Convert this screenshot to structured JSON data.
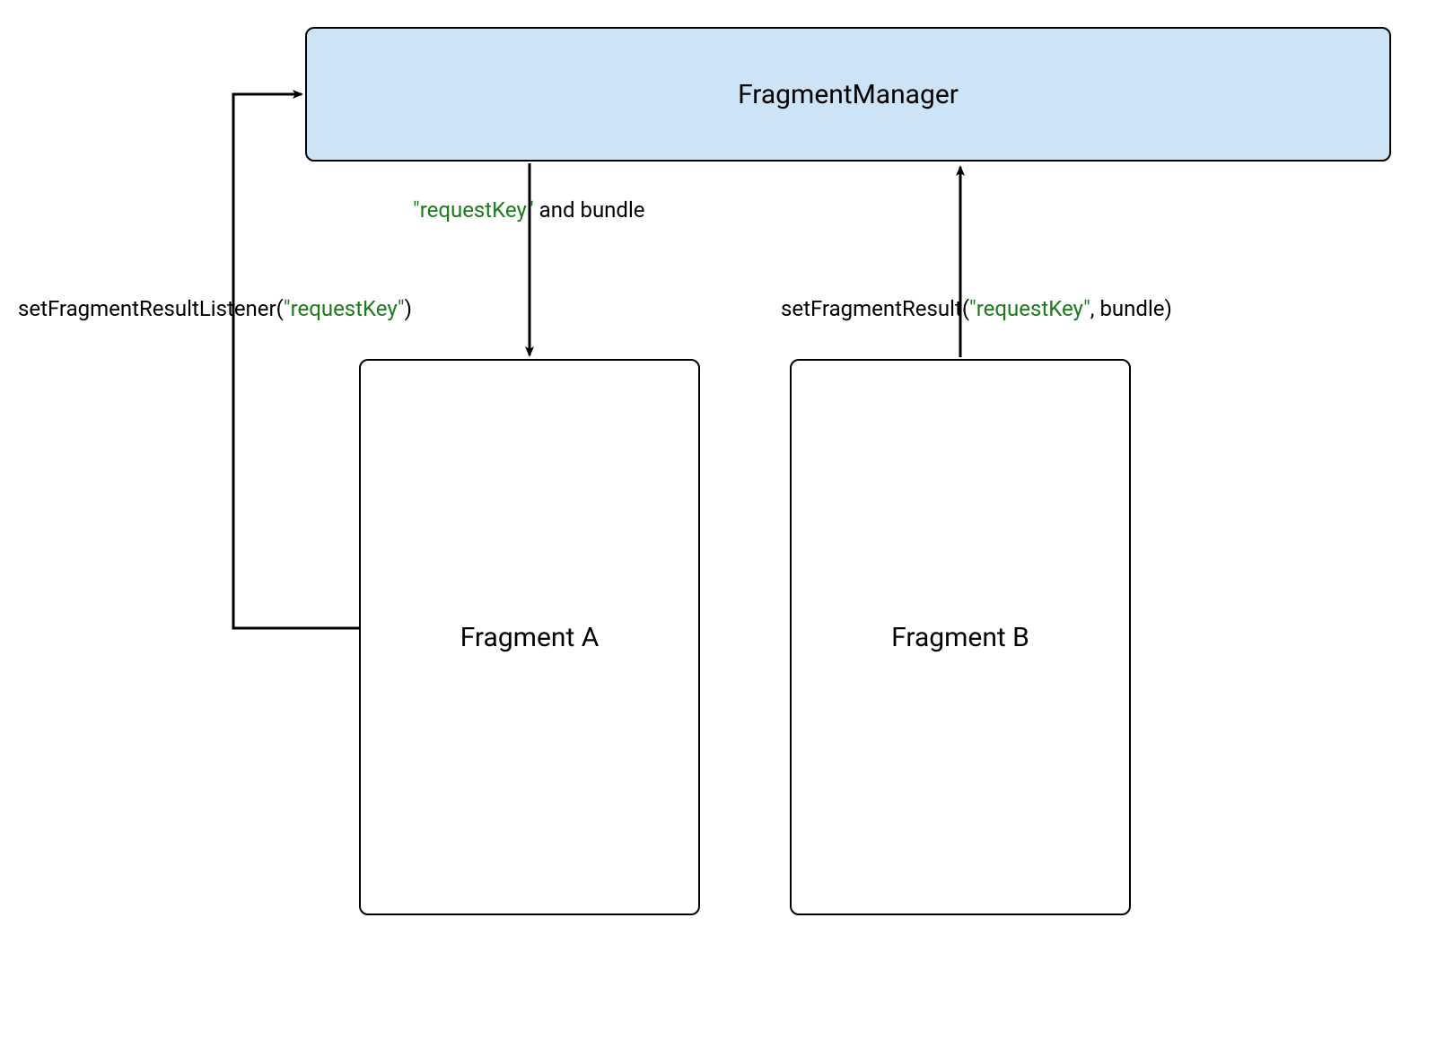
{
  "boxes": {
    "fragmentManager": {
      "label": "FragmentManager"
    },
    "fragmentA": {
      "label": "Fragment A"
    },
    "fragmentB": {
      "label": "Fragment B"
    }
  },
  "labels": {
    "left": {
      "prefix": "setFragmentResultListener(",
      "key": "\"requestKey\"",
      "suffix": ")"
    },
    "middle": {
      "key": "\"requestKey\"",
      "suffix": " and bundle"
    },
    "right": {
      "prefix": "setFragmentResult(",
      "key": "\"requestKey\"",
      "suffix": ", bundle)"
    }
  },
  "colors": {
    "managerBg": "#cce4f6",
    "stroke": "#000000",
    "keyColor": "#1b7a1b"
  }
}
